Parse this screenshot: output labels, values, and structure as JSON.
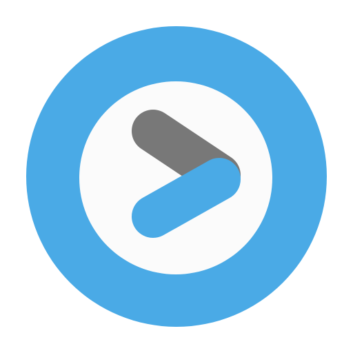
{
  "icon": {
    "name": "play-icon",
    "colors": {
      "ring": "#4aaae6",
      "inner": "#fbfbfb",
      "upper_stroke": "#787878",
      "lower_stroke": "#4aaae6",
      "background": "#ffffff"
    }
  }
}
